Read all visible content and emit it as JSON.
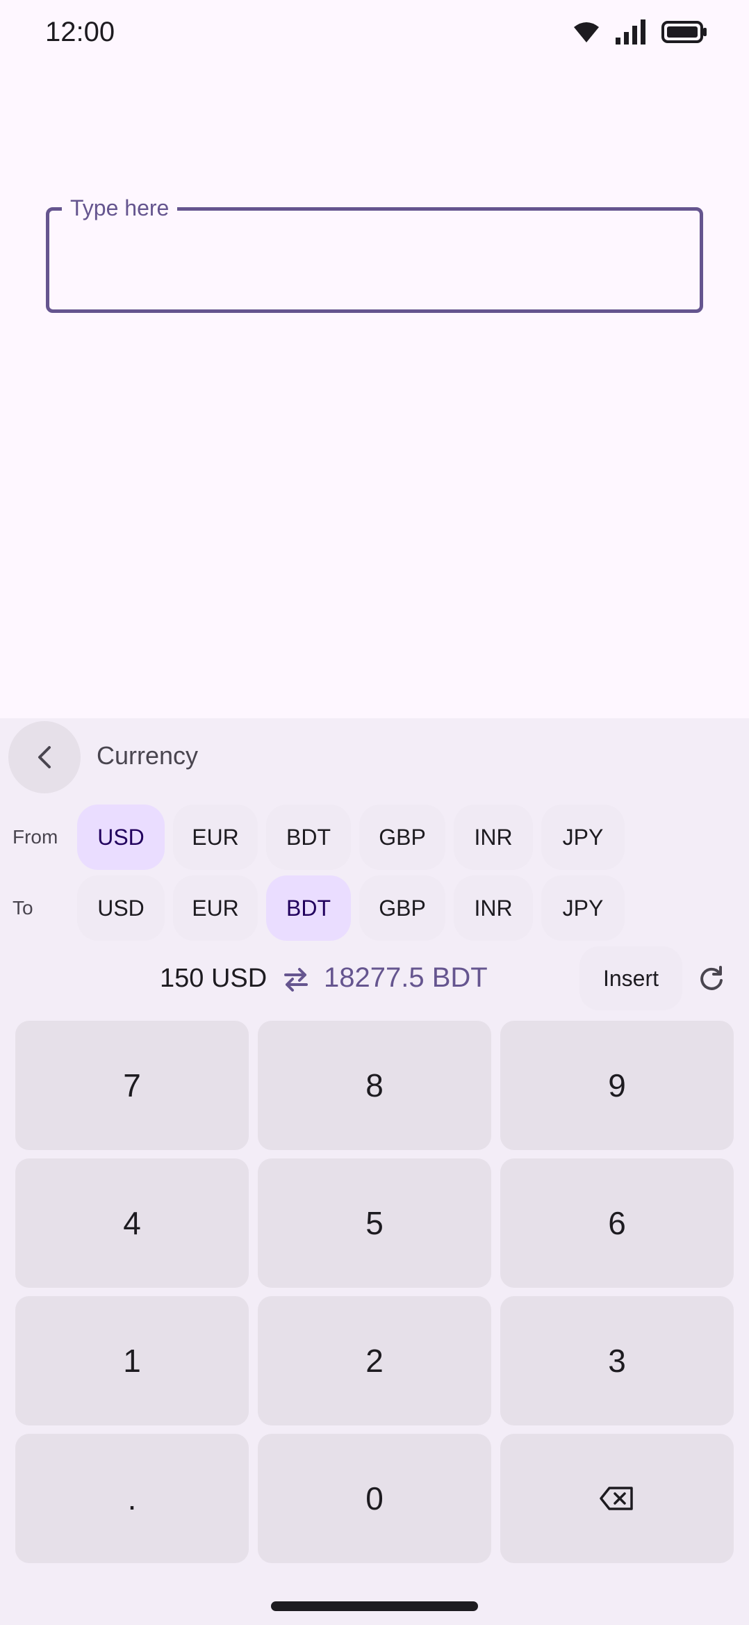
{
  "status_bar": {
    "time": "12:00",
    "icons": [
      "wifi-icon",
      "signal-icon",
      "battery-icon"
    ]
  },
  "text_field": {
    "label": "Type here",
    "value": ""
  },
  "panel": {
    "title": "Currency",
    "back_icon": "chevron-left-icon"
  },
  "from": {
    "label": "From",
    "selected": "USD",
    "options": [
      "USD",
      "EUR",
      "BDT",
      "GBP",
      "INR",
      "JPY"
    ]
  },
  "to": {
    "label": "To",
    "selected": "BDT",
    "options": [
      "USD",
      "EUR",
      "BDT",
      "GBP",
      "INR",
      "JPY"
    ]
  },
  "conversion": {
    "from_text": "150 USD",
    "to_text": "18277.5 BDT",
    "swap_icon": "swap-arrows-icon",
    "insert_label": "Insert",
    "refresh_icon": "refresh-icon"
  },
  "keypad": {
    "keys": [
      "7",
      "8",
      "9",
      "4",
      "5",
      "6",
      "1",
      "2",
      "3",
      ".",
      "0",
      "⌫"
    ]
  },
  "colors": {
    "accent": "#65558F",
    "selected_chip": "#EADDFF",
    "panel_bg": "#F3EDF7",
    "key_bg": "#E6E0E9"
  }
}
